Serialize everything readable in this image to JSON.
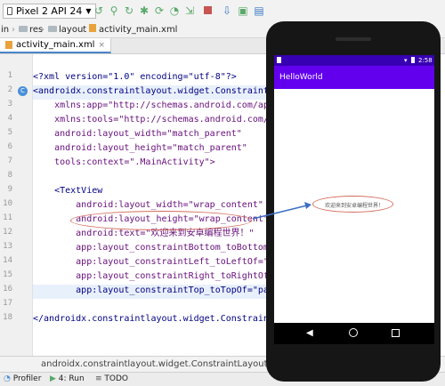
{
  "toolbar": {
    "device": "Pixel 2 API 24",
    "icons": [
      "run-icon",
      "debug-icon",
      "apply-changes-icon",
      "sync-icon",
      "profile-icon",
      "stop-icon",
      "avd-manager-icon",
      "sdk-manager-icon",
      "device-explorer-icon",
      "search-icon"
    ]
  },
  "breadcrumb": {
    "items": [
      "in",
      "res",
      "layout",
      "activity_main.xml"
    ]
  },
  "tab": {
    "label": "activity_main.xml"
  },
  "editor": {
    "lines": [
      {
        "num": "1",
        "text": "<?xml version=\"1.0\" encoding=\"utf-8\"?>"
      },
      {
        "num": "2",
        "text": "<androidx.constraintlayout.widget.ConstraintLa"
      },
      {
        "num": "3",
        "text": "    xmlns:app=\"http://schemas.android.com/apk/"
      },
      {
        "num": "4",
        "text": "    xmlns:tools=\"http://schemas.android.com/to"
      },
      {
        "num": "5",
        "text": "    android:layout_width=\"match_parent\""
      },
      {
        "num": "6",
        "text": "    android:layout_height=\"match_parent\""
      },
      {
        "num": "7",
        "text": "    tools:context=\".MainActivity\">"
      },
      {
        "num": "8",
        "text": ""
      },
      {
        "num": "9",
        "text": "    <TextView"
      },
      {
        "num": "10",
        "text": "        android:layout_width=\"wrap_content\""
      },
      {
        "num": "11",
        "text": "        android:layout_height=\"wrap_content\""
      },
      {
        "num": "12",
        "text": "        android:text=\"欢迎来到安卓编程世界！\""
      },
      {
        "num": "13",
        "text": "        app:layout_constraintBottom_toBottomOf"
      },
      {
        "num": "14",
        "text": "        app:layout_constraintLeft_toLeftOf=\"pa"
      },
      {
        "num": "15",
        "text": "        app:layout_constraintRight_toRightOf=\""
      },
      {
        "num": "16",
        "text": "        app:layout_constraintTop_toTopOf=\"pare"
      },
      {
        "num": "17",
        "text": ""
      },
      {
        "num": "18",
        "text": "</androidx.constraintlayout.widget.ConstraintLa"
      }
    ]
  },
  "status": {
    "path": "androidx.constraintlayout.widget.ConstraintLayout"
  },
  "bottom": {
    "profiler": "Profiler",
    "run": "4: Run",
    "todo": "TODO"
  },
  "emulator": {
    "time": "2:58",
    "app_title": "HelloWorld",
    "text": "欢迎来到安卓编程世界！"
  },
  "colors": {
    "app_bar": "#6200ee",
    "status_bar": "#3700b3",
    "highlight_line": "#fff6bf",
    "annotation": "#d26b5a",
    "arrow": "#3b6fc4"
  }
}
